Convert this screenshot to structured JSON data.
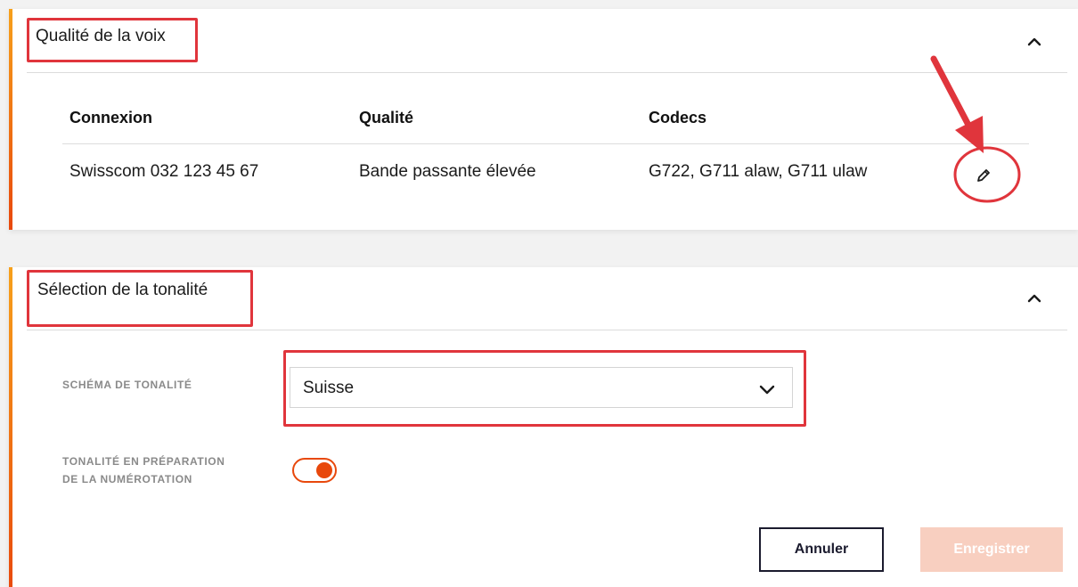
{
  "voice_quality": {
    "title": "Qualité de la voix",
    "columns": [
      "Connexion",
      "Qualité",
      "Codecs"
    ],
    "rows": [
      {
        "connection": "Swisscom 032 123 45 67",
        "quality": "Bande passante élevée",
        "codecs": "G722, G711 alaw, G711 ulaw"
      }
    ],
    "edit_icon": "pencil-icon",
    "collapse_icon": "chevron-up-icon"
  },
  "tone_selection": {
    "title": "Sélection de la tonalité",
    "collapse_icon": "chevron-up-icon",
    "tone_scheme": {
      "label": "SCHÉMA DE TONALITÉ",
      "value": "Suisse",
      "icon": "chevron-down-icon"
    },
    "dial_tone": {
      "label_line1": "TONALITÉ EN PRÉPARATION",
      "label_line2": "DE LA NUMÉROTATION",
      "enabled": true
    },
    "buttons": {
      "cancel": "Annuler",
      "save": "Enregistrer"
    }
  },
  "colors": {
    "accent": "#e8480c",
    "accent_light": "#f7a01b",
    "annotation": "#e0353c",
    "save_disabled": "#f8cfc0"
  }
}
